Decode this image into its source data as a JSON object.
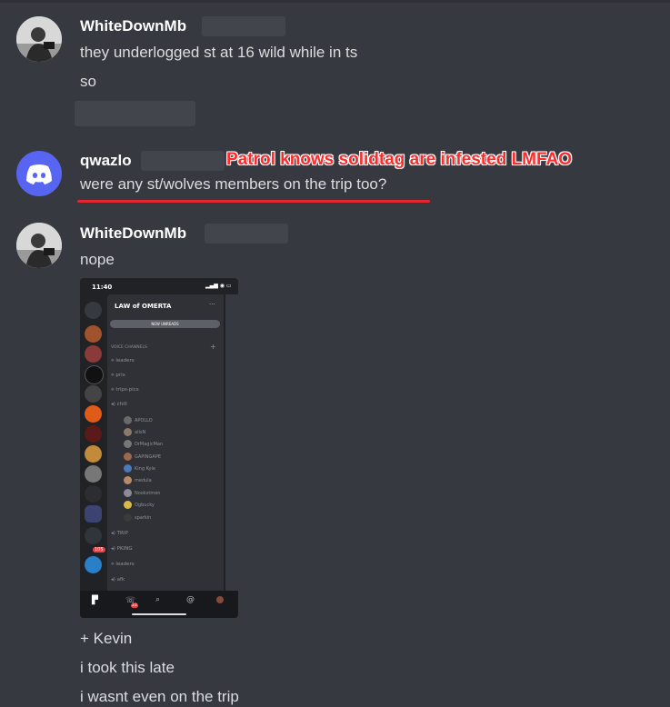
{
  "messages": [
    {
      "author": "WhiteDownMb",
      "avatar_icon": "photo-avatar",
      "lines": [
        "they underlogged st at 16 wild while in ts",
        "so"
      ]
    },
    {
      "author": "qwazlo",
      "avatar_icon": "discord-logo-icon",
      "annotation": "Patrol knows solidtag are infested LMFAO",
      "lines": [
        "were any st/wolves members on the trip too?"
      ]
    },
    {
      "author": "WhiteDownMb",
      "avatar_icon": "photo-avatar",
      "lines": [
        "nope",
        "+ Kevin",
        "i took this late",
        "i wasnt even on the trip"
      ]
    }
  ],
  "screenshot": {
    "time": "11:40",
    "server_name": "LAW of OMERTA",
    "new_unreads": "NEW UNREADS",
    "voice_header": "VOICE CHANNELS",
    "channels_top": [
      "leaders",
      "prix",
      "trips-pics",
      "chill"
    ],
    "members": [
      "APOLLO",
      "allsN",
      "DrMagicMan",
      "GAPINGAPE",
      "King Kyle",
      "medula",
      "Nookstmen",
      "Ogbucky",
      "sparkin"
    ],
    "channels_bottom": [
      "TRIP",
      "PKING",
      "leaders",
      "afk"
    ],
    "badge_count": "105",
    "bottom_badge": "23"
  },
  "colors": {
    "background": "#36393f",
    "username": "#ffffff",
    "text": "#dcddde",
    "annotation": "#ff2a2a",
    "discord_blurple": "#5865f2"
  }
}
